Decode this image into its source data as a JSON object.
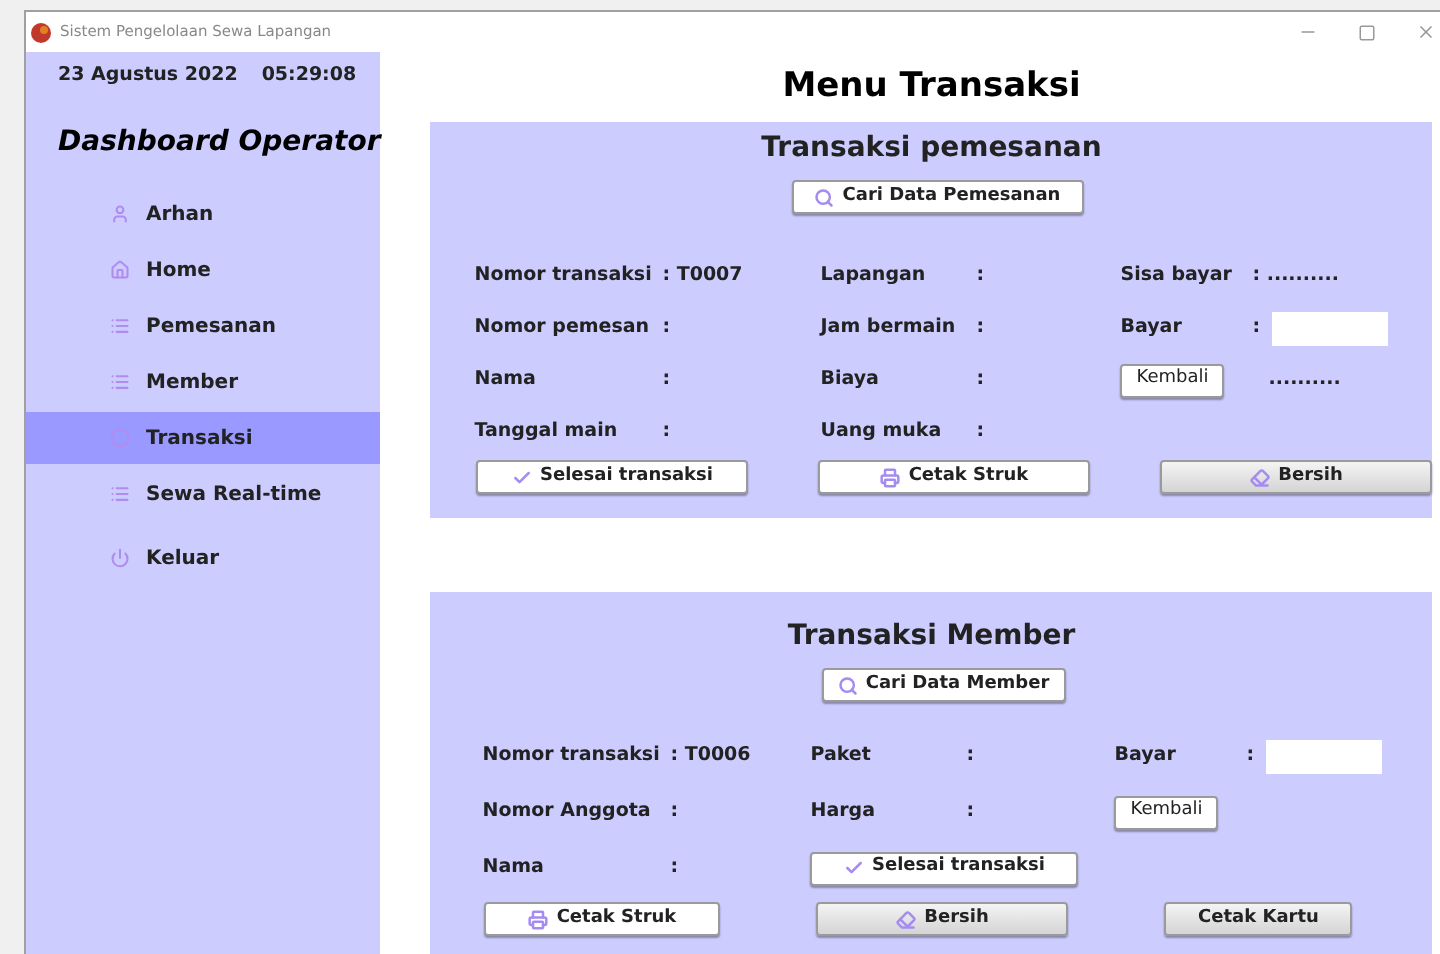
{
  "window": {
    "title": "Sistem Pengelolaan Sewa Lapangan"
  },
  "sidebar": {
    "date": "23 Agustus 2022",
    "time": "05:29:08",
    "heading": "Dashboard Operator",
    "items": [
      {
        "label": "Arhan",
        "kind": "profile",
        "selected": false
      },
      {
        "label": "Home",
        "kind": "home",
        "selected": false
      },
      {
        "label": "Pemesanan",
        "kind": "page",
        "selected": false
      },
      {
        "label": "Member",
        "kind": "page",
        "selected": false
      },
      {
        "label": "Transaksi",
        "kind": "current",
        "selected": true
      },
      {
        "label": "Sewa Real-time",
        "kind": "page",
        "selected": false
      },
      {
        "label": "Keluar",
        "kind": "exit",
        "selected": false
      }
    ]
  },
  "title": "Menu Transaksi",
  "panels": [
    {
      "title": "Transaksi pemesanan",
      "search_button": "Cari Data Pemesanan",
      "rows": [
        [
          {
            "kind": "field",
            "label": "Nomor transaksi",
            "value": ": T0007"
          },
          {
            "kind": "field",
            "label": "Lapangan",
            "value": ":"
          },
          {
            "kind": "field",
            "label": "Sisa bayar",
            "value": ": .........."
          }
        ],
        [
          {
            "kind": "field",
            "label": "Nomor pemesan",
            "value": ":"
          },
          {
            "kind": "field",
            "label": "Jam bermain",
            "value": ":"
          },
          {
            "kind": "input",
            "label": "Bayar",
            "value": ":"
          }
        ],
        [
          {
            "kind": "field",
            "label": "Nama",
            "value": ":"
          },
          {
            "kind": "field",
            "label": "Biaya",
            "value": ":"
          },
          {
            "kind": "button",
            "label": "Kembali",
            "value": ".........."
          }
        ],
        [
          {
            "kind": "field",
            "label": "Tanggal main",
            "value": ":"
          },
          {
            "kind": "field",
            "label": "Uang muka",
            "value": ":"
          }
        ]
      ],
      "buttons": [
        {
          "label": "Selesai transaksi",
          "kind": "finish"
        },
        {
          "label": "Cetak Struk",
          "kind": "print"
        },
        {
          "label": "Bersih",
          "kind": "clear"
        }
      ]
    },
    {
      "title": "Transaksi Member",
      "search_button": "Cari Data Member",
      "rows": [
        [
          {
            "kind": "field",
            "label": "Nomor transaksi",
            "value": ": T0006"
          },
          {
            "kind": "field",
            "label": "Paket",
            "value": ":"
          },
          {
            "kind": "input",
            "label": "Bayar",
            "value": ":"
          }
        ],
        [
          {
            "kind": "field",
            "label": "Nomor Anggota",
            "value": ":"
          },
          {
            "kind": "field",
            "label": "Harga",
            "value": ":"
          },
          {
            "kind": "button",
            "label": "Kembali"
          }
        ],
        [
          {
            "kind": "field",
            "label": "Nama",
            "value": ":"
          },
          {
            "kind": "finish",
            "label": "Selesai transaksi"
          }
        ]
      ],
      "buttons": [
        {
          "label": "Cetak Struk",
          "kind": "print"
        },
        {
          "label": "Bersih",
          "kind": "clear"
        },
        {
          "label": "Cetak Kartu",
          "kind": "card"
        }
      ]
    }
  ]
}
